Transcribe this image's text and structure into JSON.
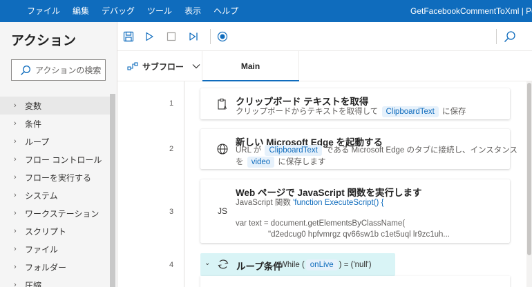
{
  "menu": {
    "items": [
      "ファイル",
      "編集",
      "デバッグ",
      "ツール",
      "表示",
      "ヘルプ"
    ],
    "window_title": "GetFacebookCommentToXml | Po"
  },
  "actions_pane": {
    "title": "アクション",
    "search_placeholder": "アクションの検索",
    "categories": [
      "変数",
      "条件",
      "ループ",
      "フロー コントロール",
      "フローを実行する",
      "システム",
      "ワークステーション",
      "スクリプト",
      "ファイル",
      "フォルダー",
      "圧縮"
    ]
  },
  "tabs": {
    "subflow_label": "サブフロー",
    "main_label": "Main"
  },
  "steps": [
    {
      "line": "1",
      "title": "クリップボード テキストを取得",
      "desc_prefix": "クリップボードからテキストを取得して",
      "var": "ClipboardText",
      "desc_suffix": "に保存"
    },
    {
      "line": "2",
      "title": "新しい Microsoft Edge を起動する",
      "desc1_prefix": "URL が",
      "var1": "ClipboardText",
      "desc1_suffix": "である Microsoft Edge のタブに接続し、インスタンス",
      "desc2_prefix": "を",
      "var2": "video",
      "desc2_suffix": "に保存します"
    },
    {
      "line": "3",
      "icon_text": "JS",
      "title": "Web ページで JavaScript 関数を実行します",
      "desc_prefix": "JavaScript 関数",
      "code1": "'function ExecuteScript() {",
      "code2": "var text = document.getElementsByClassName(",
      "code3": "\"d2edcug0 hpfvmrgz qv66sw1b c1et5uql lr9zc1uh..."
    },
    {
      "line": "4",
      "title": "ループ条件",
      "expr_prefix": "While (",
      "var": "onLive",
      "expr_suffix": ") = ('null')"
    }
  ],
  "colors": {
    "accent": "#0f6cbd",
    "loop_bg": "#d9f4f6",
    "chip_bg": "#e6f1fb"
  }
}
